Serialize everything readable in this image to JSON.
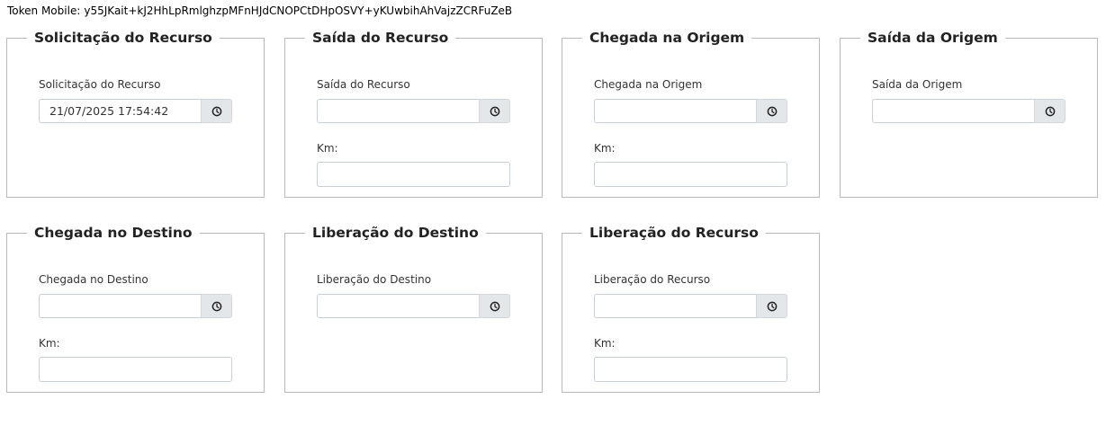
{
  "token": {
    "label": "Token Mobile:",
    "value": "y55JKait+kJ2HhLpRmlghzpMFnHJdCNOPCtDHpOSVY+yKUwbihAhVajzZCRFuZeB"
  },
  "cards": [
    {
      "title": "Solicitação do Recurso",
      "field_label": "Solicitação do Recurso",
      "value": "21/07/2025 17:54:42",
      "km_label": null
    },
    {
      "title": "Saída do Recurso",
      "field_label": "Saída do Recurso",
      "value": "",
      "km_label": "Km:"
    },
    {
      "title": "Chegada na Origem",
      "field_label": "Chegada na Origem",
      "value": "",
      "km_label": "Km:"
    },
    {
      "title": "Saída da Origem",
      "field_label": "Saída da Origem",
      "value": "",
      "km_label": null
    },
    {
      "title": "Chegada no Destino",
      "field_label": "Chegada no Destino",
      "value": "",
      "km_label": "Km:"
    },
    {
      "title": "Liberação do Destino",
      "field_label": "Liberação do Destino",
      "value": "",
      "km_label": null
    },
    {
      "title": "Liberação do Recurso",
      "field_label": "Liberação do Recurso",
      "value": "",
      "km_label": "Km:"
    }
  ],
  "icons": {
    "datetime_button": "clock-icon"
  }
}
